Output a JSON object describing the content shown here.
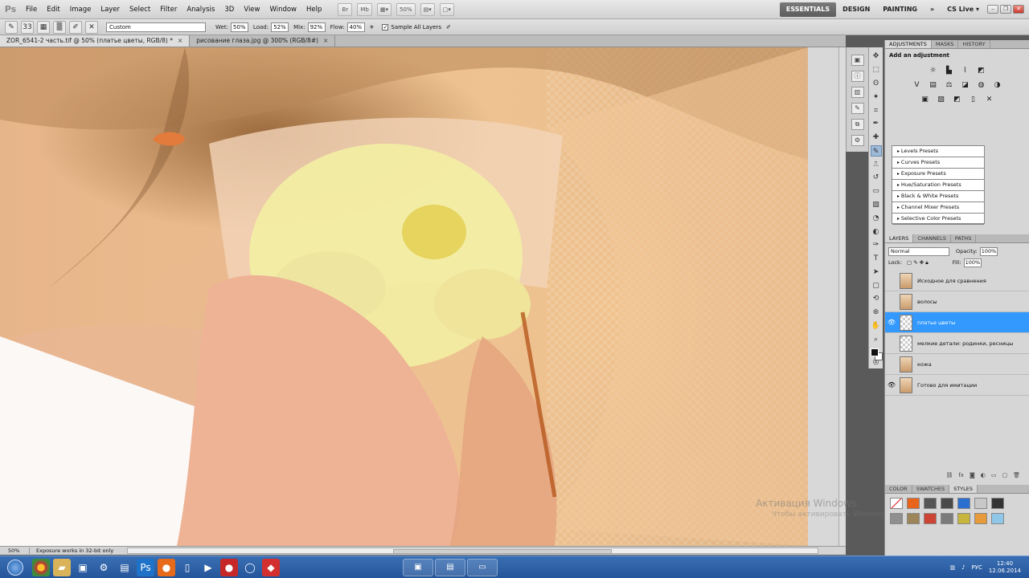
{
  "app": {
    "logo": "Ps"
  },
  "menu": [
    "File",
    "Edit",
    "Image",
    "Layer",
    "Select",
    "Filter",
    "Analysis",
    "3D",
    "View",
    "Window",
    "Help"
  ],
  "menu_tools": {
    "zoom": "50%"
  },
  "workspaces": {
    "essentials": "ESSENTIALS",
    "design": "DESIGN",
    "painting": "PAINTING",
    "more": "»",
    "cslive": "CS Live ▾"
  },
  "options": {
    "brush_size": "33",
    "preset": "Custom",
    "wet_label": "Wet:",
    "wet": "50%",
    "load_label": "Load:",
    "load": "52%",
    "mix_label": "Mix:",
    "mix": "92%",
    "flow_label": "Flow:",
    "flow": "40%",
    "sample_label": "Sample All Layers"
  },
  "tabs": [
    {
      "label": "ZOR_6541-2 часть.tif @ 50% (платье цветы, RGB/8) *"
    },
    {
      "label": "рисование глаза.jpg @ 300% (RGB/8#)"
    }
  ],
  "status": {
    "zoom": "50%",
    "message": "Exposure works in 32-bit only"
  },
  "panels": {
    "adj_tabs": [
      "ADJUSTMENTS",
      "MASKS",
      "HISTORY"
    ],
    "add_adjustment": "Add an adjustment",
    "presets": [
      "Levels Presets",
      "Curves Presets",
      "Exposure Presets",
      "Hue/Saturation Presets",
      "Black & White Presets",
      "Channel Mixer Presets",
      "Selective Color Presets"
    ],
    "layer_tabs": [
      "LAYERS",
      "CHANNELS",
      "PATHS"
    ],
    "blend_mode": "Normal",
    "opacity_label": "Opacity:",
    "opacity": "100%",
    "lock_label": "Lock:",
    "fill_label": "Fill:",
    "fill": "100%",
    "layers": [
      {
        "name": "Исходное для сравнения",
        "visible": false,
        "selected": false
      },
      {
        "name": "волосы",
        "visible": false,
        "selected": false
      },
      {
        "name": "платье цветы",
        "visible": true,
        "selected": true
      },
      {
        "name": "мелкие детали: родинки, ресницы",
        "visible": false,
        "selected": false
      },
      {
        "name": "кожа",
        "visible": false,
        "selected": false
      },
      {
        "name": "Готово для имитации",
        "visible": true,
        "selected": false
      }
    ],
    "color_tabs": [
      "COLOR",
      "SWATCHES",
      "STYLES"
    ]
  },
  "watermark": {
    "line1": "Активация Windows",
    "line2": "Чтобы активировать Windows"
  },
  "taskbar": {
    "language": "РУС",
    "time": "12:40",
    "date": "12.06.2014"
  },
  "colors": {
    "accent": "#3399ff",
    "taskbar": "#2c5fa6"
  }
}
